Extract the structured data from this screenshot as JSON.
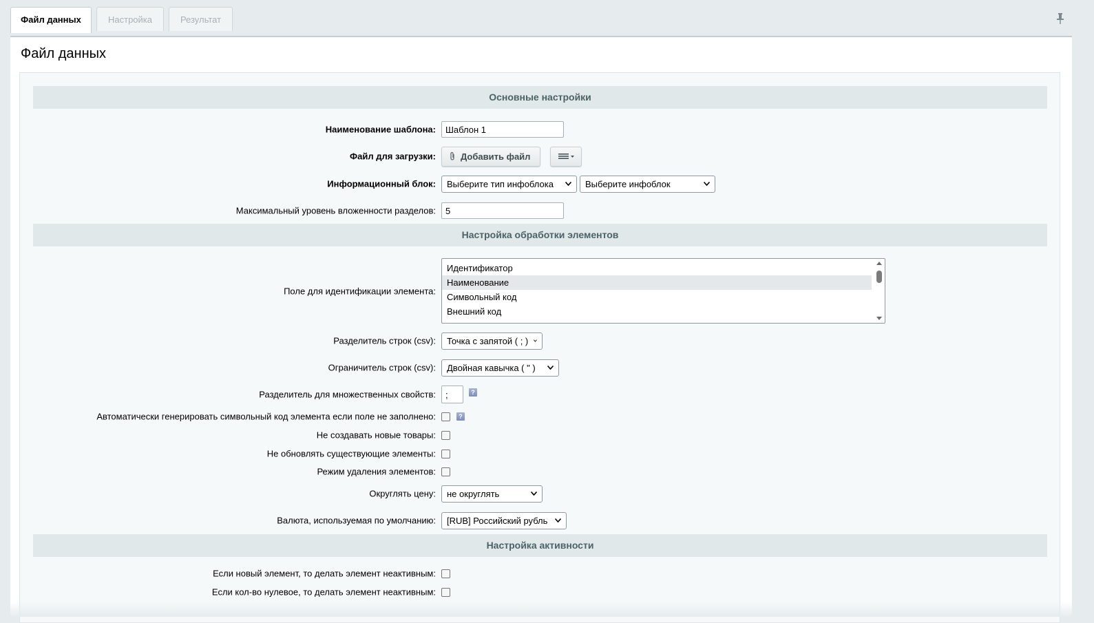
{
  "tabs": [
    "Файл данных",
    "Настройка",
    "Результат"
  ],
  "page_title": "Файл данных",
  "sections": {
    "main": "Основные настройки",
    "processing": "Настройка обработки элементов",
    "activity": "Настройка активности"
  },
  "fields": {
    "template_name": {
      "label": "Наименование шаблона:",
      "value": "Шаблон 1"
    },
    "upload_file": {
      "label": "Файл для загрузки:",
      "button": "Добавить файл"
    },
    "iblock": {
      "label": "Информационный блок:",
      "type_value": "Выберите тип инфоблока",
      "iblock_value": "Выберите инфоблок"
    },
    "max_depth": {
      "label": "Максимальный уровень вложенности разделов:",
      "value": "5"
    },
    "id_field": {
      "label": "Поле для идентификации элемента:",
      "options": [
        "Идентификатор",
        "Наименование",
        "Символьный код",
        "Внешний код"
      ],
      "selected": "Наименование"
    },
    "row_sep": {
      "label": "Разделитель строк (csv):",
      "value": "Точка с запятой ( ; )"
    },
    "row_enc": {
      "label": "Ограничитель строк (csv):",
      "value": "Двойная кавычка ( \" )"
    },
    "multi_sep": {
      "label": "Разделитель для множественных свойств:",
      "value": ";",
      "help": "?"
    },
    "auto_code": {
      "label": "Автоматически генерировать символьный код элемента если поле не заполнено:",
      "help": "?"
    },
    "no_new": {
      "label": "Не создавать новые товары:"
    },
    "no_update": {
      "label": "Не обновлять существующие элементы:"
    },
    "delete_mode": {
      "label": "Режим удаления элементов:"
    },
    "round_price": {
      "label": "Округлять цену:",
      "value": "не округлять"
    },
    "currency": {
      "label": "Валюта, используемая по умолчанию:",
      "value": "[RUB] Российский рубль"
    },
    "new_inactive": {
      "label": "Если новый элемент, то делать элемент неактивным:"
    },
    "zero_inactive": {
      "label": "Если кол-во нулевое, то делать элемент неактивным:"
    }
  },
  "icons": {
    "pin": "pin-icon",
    "paperclip": "paperclip-icon",
    "menu": "menu-icon",
    "chevron": "chevron-down-icon"
  }
}
